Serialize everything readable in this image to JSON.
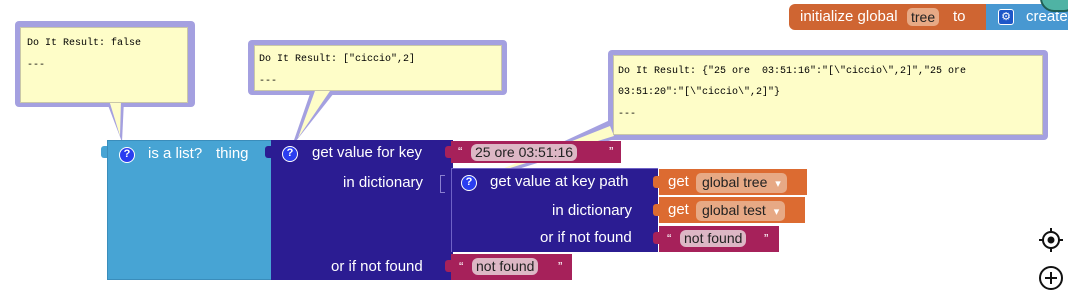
{
  "init_block": {
    "prefix": "initialize global",
    "name": "tree",
    "to": "to",
    "create": "create"
  },
  "bubbles": {
    "islist": {
      "line1": "Do It Result: false",
      "line2": "---"
    },
    "getvalue": {
      "line1": "Do It Result: [\"ciccio\",2]",
      "line2": "---"
    },
    "keypath": {
      "line1": "Do It Result: {\"25 ore  03:51:16\":\"[\\\"ciccio\\\",2]\",\"25 ore",
      "line2": "03:51:20\":\"[\\\"ciccio\\\",2]\"}",
      "line3": "---"
    }
  },
  "is_list": {
    "label": "is a list?",
    "arg": "thing"
  },
  "get_value": {
    "label": "get value for key",
    "key_text": "25 ore  03:51:16",
    "in_dictionary": "in dictionary",
    "or_if_not_found": "or if not found",
    "not_found_text": "not found"
  },
  "key_path": {
    "label": "get value at key path",
    "in_dictionary": "in dictionary",
    "or_if_not_found": "or if not found",
    "not_found_text": "not found"
  },
  "getters": [
    {
      "get": "get",
      "var": "global tree"
    },
    {
      "get": "get",
      "var": "global test"
    }
  ],
  "icons": {
    "help": "?",
    "dropdown": "▾",
    "open_quote": "“",
    "close_quote": "”"
  }
}
